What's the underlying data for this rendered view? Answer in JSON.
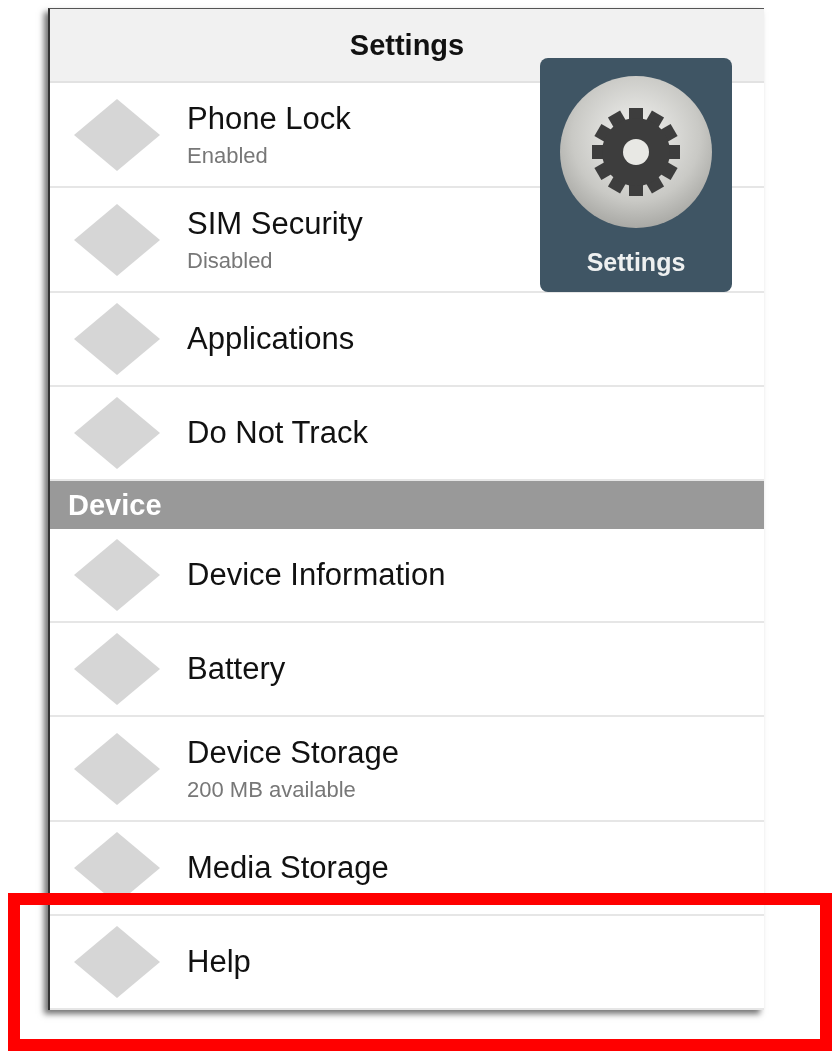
{
  "header": {
    "title": "Settings"
  },
  "sections": [
    {
      "items": [
        {
          "label": "Phone Lock",
          "subtitle": "Enabled"
        },
        {
          "label": "SIM Security",
          "subtitle": "Disabled"
        },
        {
          "label": "Applications"
        },
        {
          "label": "Do Not Track"
        }
      ]
    },
    {
      "title": "Device",
      "items": [
        {
          "label": "Device Information"
        },
        {
          "label": "Battery"
        },
        {
          "label": "Device Storage",
          "subtitle": "200 MB available"
        },
        {
          "label": "Media Storage"
        },
        {
          "label": "Help"
        }
      ]
    }
  ],
  "app_tile": {
    "label": "Settings"
  }
}
